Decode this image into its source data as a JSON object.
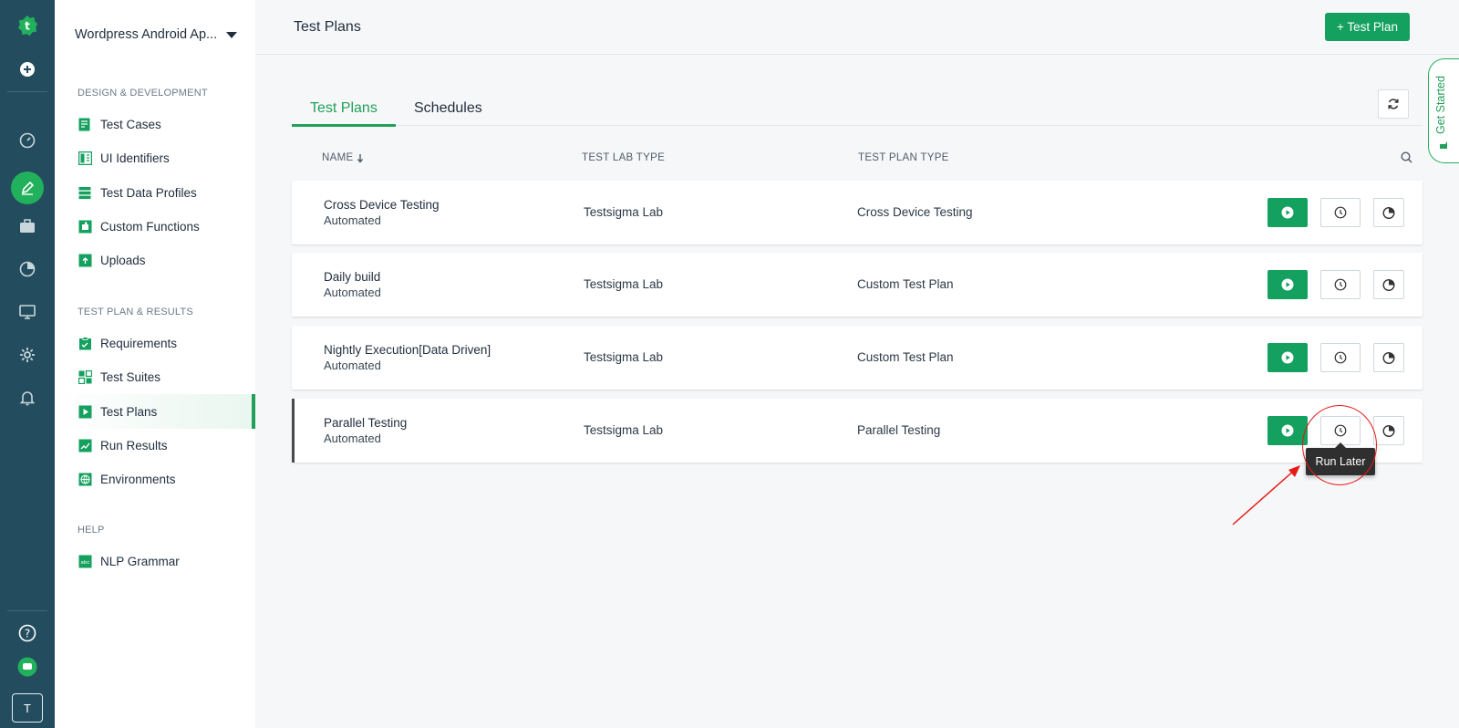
{
  "app": {
    "logo_letter": "t"
  },
  "rail": {
    "avatar_letter": "T"
  },
  "sidebar": {
    "project_name": "Wordpress Android Ap...",
    "sections": [
      {
        "title": "DESIGN & DEVELOPMENT"
      },
      {
        "title": "TEST PLAN & RESULTS"
      },
      {
        "title": "HELP"
      }
    ],
    "items": [
      {
        "label": "Test Cases",
        "icon": "test-cases-icon"
      },
      {
        "label": "UI Identifiers",
        "icon": "ui-identifiers-icon"
      },
      {
        "label": "Test Data Profiles",
        "icon": "test-data-icon"
      },
      {
        "label": "Custom Functions",
        "icon": "puzzle-icon"
      },
      {
        "label": "Uploads",
        "icon": "upload-icon"
      },
      {
        "label": "Requirements",
        "icon": "clipboard-icon"
      },
      {
        "label": "Test Suites",
        "icon": "test-suites-icon"
      },
      {
        "label": "Test Plans",
        "icon": "play-icon",
        "active": true
      },
      {
        "label": "Run Results",
        "icon": "chart-icon"
      },
      {
        "label": "Environments",
        "icon": "globe-icon"
      },
      {
        "label": "NLP Grammar",
        "icon": "abc-icon"
      }
    ]
  },
  "header": {
    "title": "Test Plans",
    "add_button": "+ Test Plan"
  },
  "get_started": "Get Started",
  "tabs": [
    {
      "label": "Test Plans",
      "active": true
    },
    {
      "label": "Schedules"
    }
  ],
  "columns": {
    "name": "NAME",
    "lab_type": "TEST LAB TYPE",
    "plan_type": "TEST PLAN TYPE"
  },
  "rows": [
    {
      "name": "Cross Device Testing",
      "mode": "Automated",
      "lab": "Testsigma Lab",
      "type": "Cross Device Testing"
    },
    {
      "name": "Daily build",
      "mode": "Automated",
      "lab": "Testsigma Lab",
      "type": "Custom Test Plan"
    },
    {
      "name": "Nightly Execution[Data Driven]",
      "mode": "Automated",
      "lab": "Testsigma Lab",
      "type": "Custom Test Plan"
    },
    {
      "name": "Parallel Testing",
      "mode": "Automated",
      "lab": "Testsigma Lab",
      "type": "Parallel Testing"
    }
  ],
  "tooltip": "Run Later",
  "colors": {
    "accent": "#14a05f",
    "rail": "#234d5e",
    "annotation": "#e41b17"
  }
}
